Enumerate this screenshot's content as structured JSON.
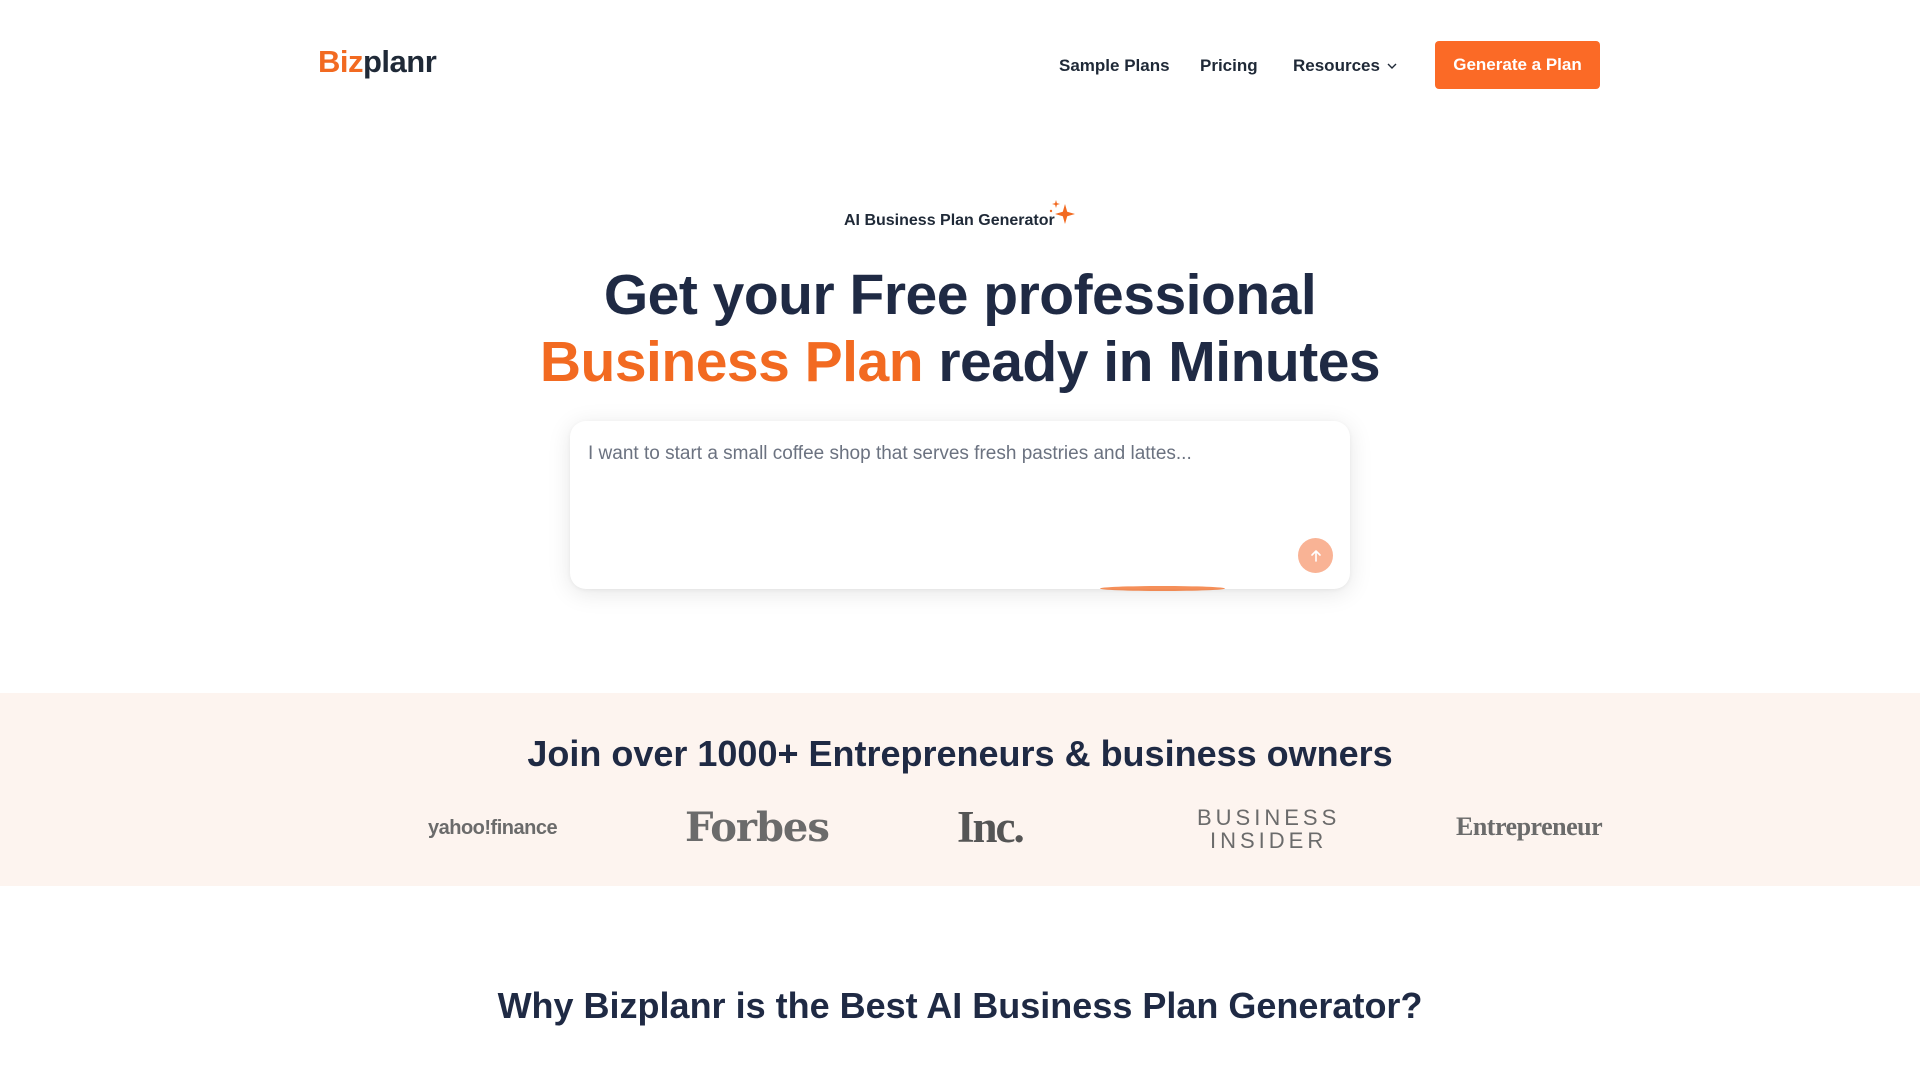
{
  "header": {
    "logo": {
      "part1": "Biz",
      "part2": "planr"
    },
    "nav": {
      "sample_plans": "Sample Plans",
      "pricing": "Pricing",
      "resources": "Resources"
    },
    "cta_label": "Generate a Plan"
  },
  "hero": {
    "eyebrow": "AI Business Plan Generator",
    "headline_line1": "Get your Free professional",
    "headline_accent": "Business Plan",
    "headline_rest": " ready in Minutes",
    "prompt_placeholder": "I want to start a small coffee shop that serves fresh pastries and lattes..."
  },
  "social_proof": {
    "title": "Join over 1000+ Entrepreneurs & business owners",
    "logos": {
      "yahoo_finance": "yahoo!finance",
      "forbes": "Forbes",
      "inc": "Inc.",
      "business_insider_line1": "BUSINESS",
      "business_insider_line2": "INSIDER",
      "entrepreneur": "Entrepreneur"
    }
  },
  "why": {
    "title": "Why Bizplanr is the Best AI Business Plan Generator?"
  },
  "colors": {
    "brand_orange": "#f26a21",
    "cta_orange": "#fb6a26",
    "heading_navy": "#1f2a44",
    "band_background": "#fdf4ef"
  },
  "icons": {
    "resources_chevron": "chevron-down-icon",
    "sparkle": "sparkle-icon",
    "send": "arrow-up-icon"
  }
}
